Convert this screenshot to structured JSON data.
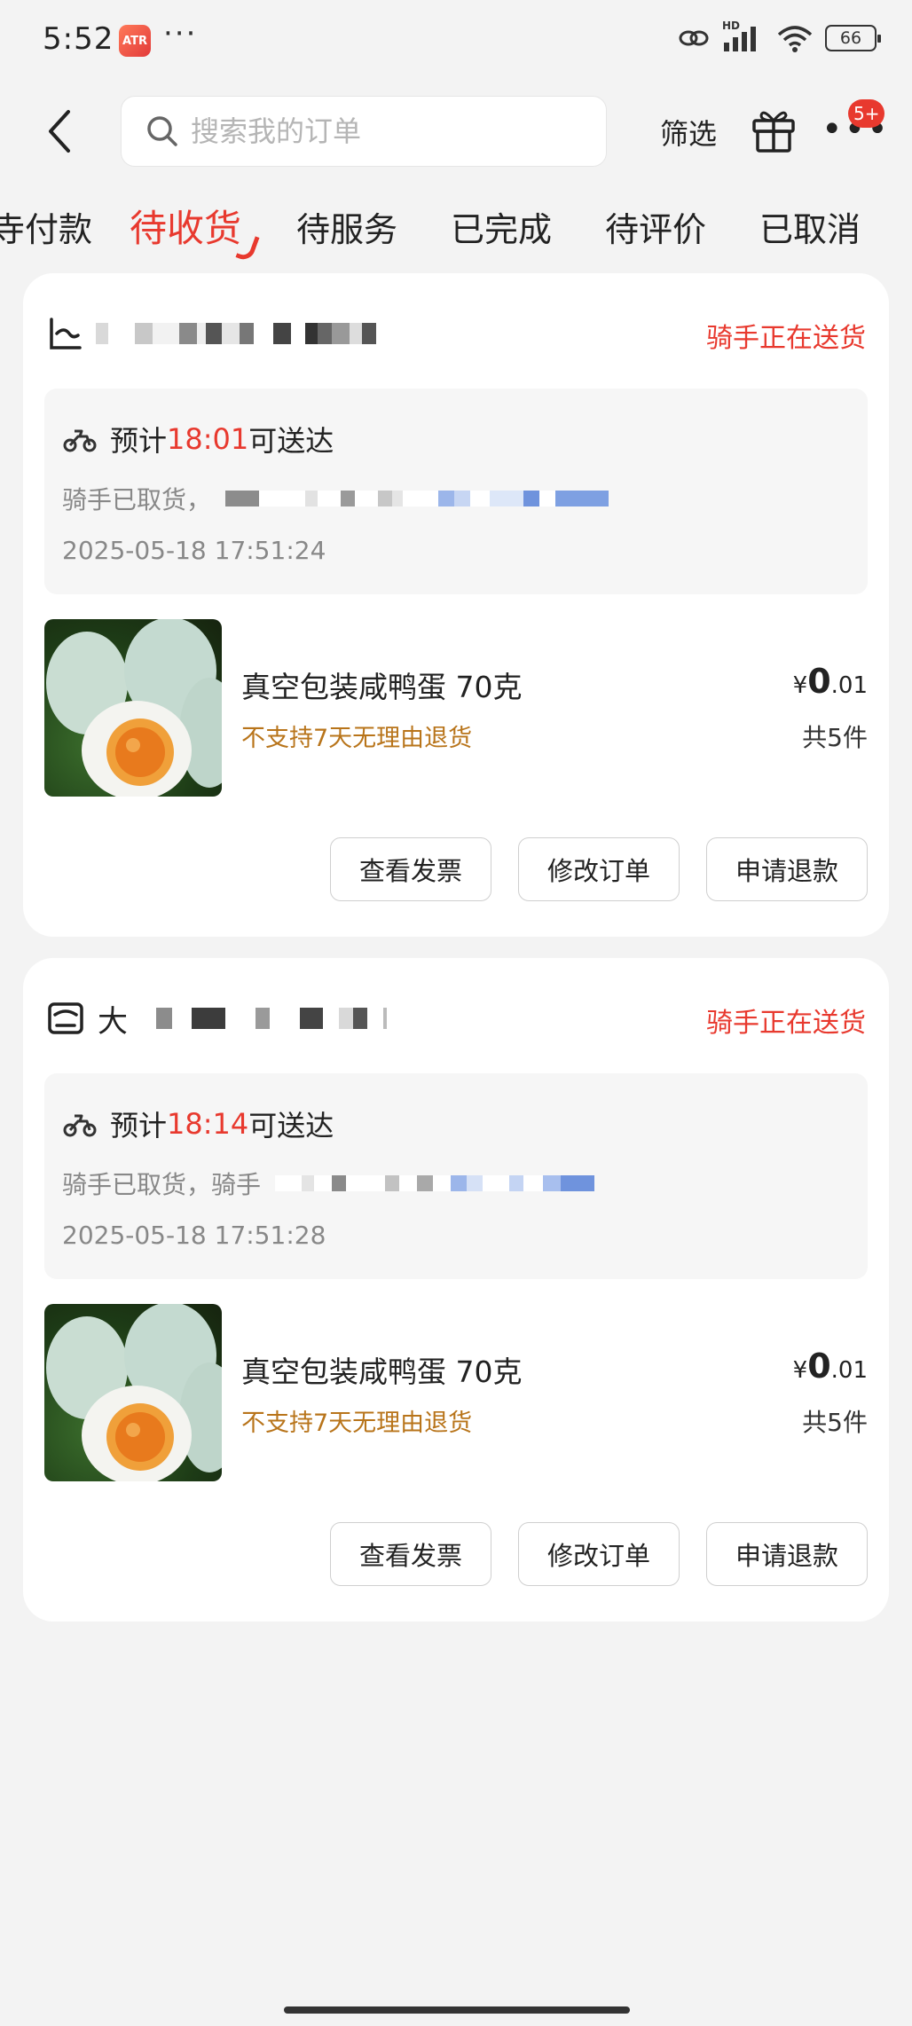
{
  "status_bar": {
    "time": "5:52",
    "app_icon_text": "ATR",
    "dots": "···",
    "network": "HD",
    "battery": "66"
  },
  "header": {
    "search_placeholder": "搜索我的订单",
    "filter_label": "筛选",
    "badge": "5+"
  },
  "tabs": [
    {
      "label": "待付款",
      "partial": "寺付款"
    },
    {
      "label": "待收货",
      "active": true
    },
    {
      "label": "待服务"
    },
    {
      "label": "已完成"
    },
    {
      "label": "待评价"
    },
    {
      "label": "已取消"
    }
  ],
  "orders": [
    {
      "shop_prefix": "",
      "status": "骑手正在送货",
      "eta_prefix": "预计",
      "eta_time": "18:01",
      "eta_suffix": "可送达",
      "rider_text": "骑手已取货，",
      "timestamp": "2025-05-18 17:51:24",
      "product_name": "真空包装咸鸭蛋 70克",
      "product_note": "不支持7天无理由退货",
      "price_currency": "¥",
      "price_int": "0",
      "price_dec": ".01",
      "quantity": "共5件",
      "buttons": [
        "查看发票",
        "修改订单",
        "申请退款"
      ]
    },
    {
      "shop_prefix": "大",
      "status": "骑手正在送货",
      "eta_prefix": "预计",
      "eta_time": "18:14",
      "eta_suffix": "可送达",
      "rider_text": "骑手已取货，骑手",
      "timestamp": "2025-05-18 17:51:28",
      "product_name": "真空包装咸鸭蛋 70克",
      "product_note": "不支持7天无理由退货",
      "price_currency": "¥",
      "price_int": "0",
      "price_dec": ".01",
      "quantity": "共5件",
      "buttons": [
        "查看发票",
        "修改订单",
        "申请退款"
      ]
    }
  ],
  "colors": {
    "accent": "#e8392e",
    "note": "#b8741a",
    "background": "#f3f3f3"
  }
}
